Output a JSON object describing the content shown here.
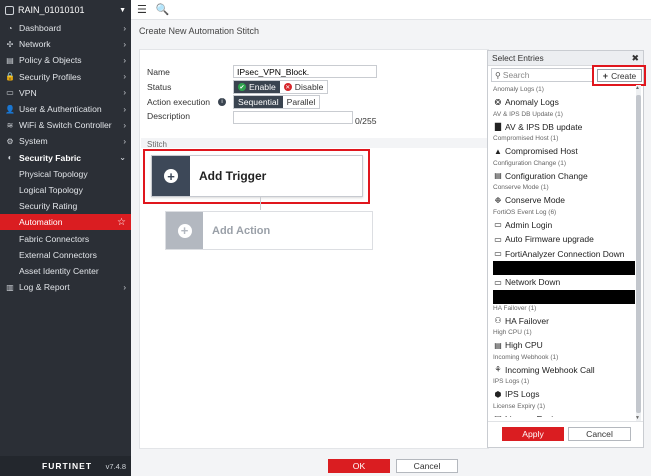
{
  "sidebar": {
    "device": "RAIN_01010101",
    "items": [
      {
        "label": "Dashboard",
        "icon": "dashboard-icon",
        "glyph": "◔",
        "arrow": "›"
      },
      {
        "label": "Network",
        "icon": "network-icon",
        "glyph": "✣",
        "arrow": "›"
      },
      {
        "label": "Policy & Objects",
        "icon": "policy-icon",
        "glyph": "▤",
        "arrow": "›"
      },
      {
        "label": "Security Profiles",
        "icon": "lock-icon",
        "glyph": "🔒",
        "arrow": "›"
      },
      {
        "label": "VPN",
        "icon": "vpn-icon",
        "glyph": "▭",
        "arrow": "›"
      },
      {
        "label": "User & Authentication",
        "icon": "user-icon",
        "glyph": "👤",
        "arrow": "›"
      },
      {
        "label": "WiFi & Switch Controller",
        "icon": "wifi-icon",
        "glyph": "≋",
        "arrow": "›"
      },
      {
        "label": "System",
        "icon": "gear-icon",
        "glyph": "⚙",
        "arrow": "›"
      }
    ],
    "open_section": {
      "label": "Security Fabric",
      "icon": "security-fabric-icon",
      "glyph": "◐",
      "arrow": "⌄"
    },
    "sub_items": [
      "Physical Topology",
      "Logical Topology",
      "Security Rating"
    ],
    "active_item": "Automation",
    "sub_items_after": [
      "Fabric Connectors",
      "External Connectors",
      "Asset Identity Center"
    ],
    "last_item": {
      "label": "Log & Report",
      "icon": "log-icon",
      "glyph": "▥",
      "arrow": "›"
    },
    "logo": "FURTINET",
    "version": "v7.4.8"
  },
  "topbar": {
    "menu_glyph": "☰",
    "search_glyph": "🔍"
  },
  "page": {
    "title": "Create New Automation Stitch"
  },
  "form": {
    "name_label": "Name",
    "name_value": "IPsec_VPN_Block.",
    "status_label": "Status",
    "status_enable": "Enable",
    "status_disable": "Disable",
    "exec_label": "Action execution",
    "exec_sequential": "Sequential",
    "exec_parallel": "Parallel",
    "desc_label": "Description",
    "desc_count": "0/255",
    "stitch_label": "Stitch"
  },
  "stitch": {
    "add_trigger": "Add Trigger",
    "add_action": "Add Action"
  },
  "panel": {
    "title": "Select Entries",
    "close": "✖",
    "search_placeholder": "Search",
    "create_label": "Create",
    "entries": [
      {
        "group": "Anomaly Logs (1)",
        "name": "Anomaly Logs",
        "icon": "anomaly-icon",
        "glyph": "❂"
      },
      {
        "group": "AV & IPS DB Update (1)",
        "name": "AV & IPS DB update",
        "icon": "database-icon",
        "glyph": "▇"
      },
      {
        "group": "Compromised Host (1)",
        "name": "Compromised Host",
        "icon": "warning-icon",
        "glyph": "▲"
      },
      {
        "group": "Configuration Change (1)",
        "name": "Configuration Change",
        "icon": "config-icon",
        "glyph": "▤"
      },
      {
        "group": "Conserve Mode (1)",
        "name": "Conserve Mode",
        "icon": "conserve-icon",
        "glyph": "❉"
      }
    ],
    "event_group": "FortiOS Event Log (6)",
    "event_entries": [
      {
        "name": "Admin Login",
        "icon": "login-icon",
        "glyph": "▭"
      },
      {
        "name": "Auto Firmware upgrade",
        "icon": "upgrade-icon",
        "glyph": "▭"
      },
      {
        "name": "FortiAnalyzer Connection Down",
        "icon": "analyzer-icon",
        "glyph": "▭"
      }
    ],
    "network_down": "Network Down",
    "entries2": [
      {
        "group": "HA Failover (1)",
        "name": "HA Failover",
        "icon": "ha-icon",
        "glyph": "⚇"
      },
      {
        "group": "High CPU (1)",
        "name": "High CPU",
        "icon": "cpu-icon",
        "glyph": "▤"
      },
      {
        "group": "Incoming Webhook (1)",
        "name": "Incoming Webhook Call",
        "icon": "webhook-icon",
        "glyph": "⚘"
      },
      {
        "group": "IPS Logs (1)",
        "name": "IPS Logs",
        "icon": "shield-icon",
        "glyph": "⬢"
      },
      {
        "group": "License Expiry (1)",
        "name": "License Expiry",
        "icon": "license-icon",
        "glyph": "▤"
      }
    ],
    "apply": "Apply",
    "cancel": "Cancel"
  },
  "footer": {
    "ok": "OK",
    "cancel": "Cancel"
  },
  "colors": {
    "accent": "#da1d21",
    "sidebar": "#2b2f36",
    "highlight": "#e0161d"
  }
}
